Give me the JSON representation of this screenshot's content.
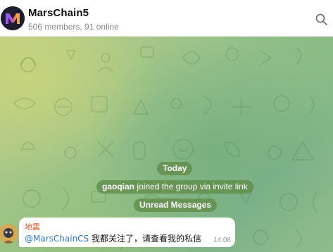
{
  "header": {
    "title": "MarsChain5",
    "subtitle": "506 members, 91 online",
    "search_icon": "search-icon"
  },
  "chat": {
    "date_separator": "Today",
    "service_message": {
      "user": "gaoqian",
      "text": "joined the group via invite link"
    },
    "unread_label": "Unread Messages",
    "message": {
      "sender": "地震",
      "mention": "@MarsChainCS",
      "text": "我都关注了，请查看我的私信",
      "time": "14:08"
    }
  },
  "colors": {
    "sender_name": "#e05b2a",
    "mention_link": "#2b7bd0",
    "service_pill": "#608c48",
    "header_bg": "#ffffff"
  }
}
